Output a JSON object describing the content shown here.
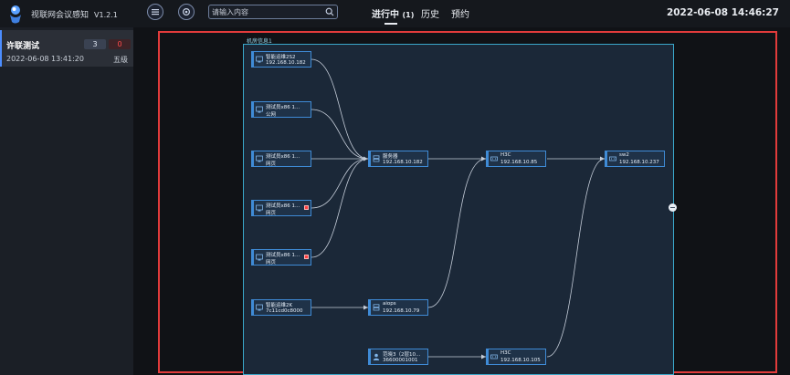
{
  "header": {
    "app_title": "视联网会议感知",
    "version": "V1.2.1",
    "search_placeholder": "请输入内容",
    "tabs": [
      {
        "label": "进行中",
        "count": "(1)"
      },
      {
        "label": "历史"
      },
      {
        "label": "预约"
      }
    ],
    "datetime": "2022-06-08 14:46:27"
  },
  "meetings": [
    {
      "name": "许联测试",
      "count_a": "3",
      "count_b": "0",
      "time": "2022-06-08 13:41:20",
      "extra": "五级"
    }
  ],
  "topology": {
    "title": "机房信息1",
    "nodes": [
      {
        "name": "智能运维2S2",
        "sub": "192.168.10.182",
        "icon": "device-icon"
      },
      {
        "name": "测试员x86 1...",
        "sub": "公网",
        "icon": "device-icon"
      },
      {
        "name": "测试员x86 1...",
        "sub": "网页",
        "icon": "device-icon"
      },
      {
        "name": "测试员x86 1...",
        "sub": "网页",
        "icon": "device-icon",
        "alert": true
      },
      {
        "name": "测试员x86 1...",
        "sub": "网页",
        "icon": "device-icon",
        "alert": true
      },
      {
        "name": "智能运维2K",
        "sub": "7c11cd0c8000",
        "icon": "device-icon"
      },
      {
        "name": "服务器",
        "sub": "192.168.10.182",
        "icon": "server-icon"
      },
      {
        "name": "aiops",
        "sub": "192.168.10.79",
        "icon": "server-icon"
      },
      {
        "name": "H3C",
        "sub": "192.168.10.85",
        "icon": "switch-icon"
      },
      {
        "name": "sw2",
        "sub": "192.168.10.237",
        "icon": "switch-icon"
      },
      {
        "name": "范晓3（2层10...",
        "sub": "36600001001",
        "icon": "person-icon"
      },
      {
        "name": "H3C",
        "sub": "192.168.10.105",
        "icon": "switch-icon"
      }
    ]
  },
  "colors": {
    "accent": "#4c8dff",
    "highlight_frame": "#e23b3b",
    "panel_border": "#3aa7c9",
    "node_border": "#3f8bd6",
    "alert": "#ff4040"
  }
}
